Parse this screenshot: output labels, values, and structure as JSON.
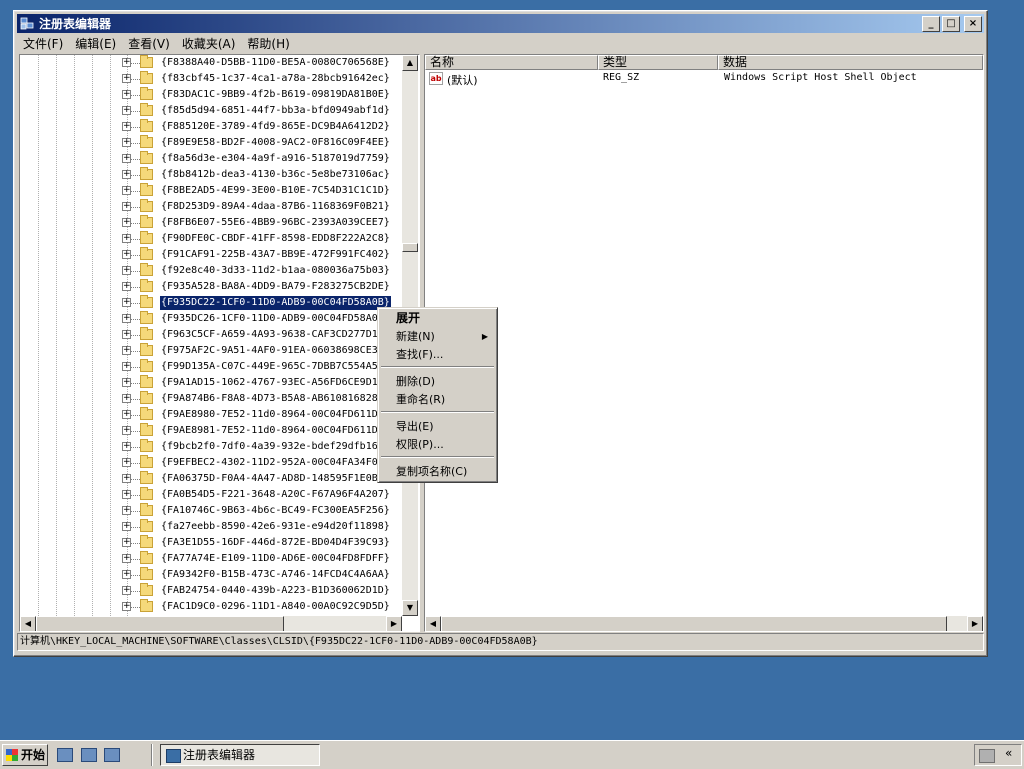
{
  "window": {
    "title": "注册表编辑器",
    "buttons": {
      "minimize": "_",
      "maximize": "□",
      "close": "×"
    }
  },
  "menubar": [
    "文件(F)",
    "编辑(E)",
    "查看(V)",
    "收藏夹(A)",
    "帮助(H)"
  ],
  "tree": {
    "selected_index": 15,
    "items": [
      "{F8388A40-D5BB-11D0-BE5A-0080C706568E}",
      "{f83cbf45-1c37-4ca1-a78a-28bcb91642ec}",
      "{F83DAC1C-9BB9-4f2b-B619-09819DA81B0E}",
      "{f85d5d94-6851-44f7-bb3a-bfd0949abf1d}",
      "{F885120E-3789-4fd9-865E-DC9B4A6412D2}",
      "{F89E9E58-BD2F-4008-9AC2-0F816C09F4EE}",
      "{f8a56d3e-e304-4a9f-a916-5187019d7759}",
      "{f8b8412b-dea3-4130-b36c-5e8be73106ac}",
      "{F8BE2AD5-4E99-3E00-B10E-7C54D31C1C1D}",
      "{F8D253D9-89A4-4daa-87B6-1168369F0B21}",
      "{F8FB6E07-55E6-4BB9-96BC-2393A039CEE7}",
      "{F90DFE0C-CBDF-41FF-8598-EDD8F222A2C8}",
      "{F91CAF91-225B-43A7-BB9E-472F991FC402}",
      "{f92e8c40-3d33-11d2-b1aa-080036a75b03}",
      "{F935A528-BA8A-4DD9-BA79-F283275CB2DE}",
      "{F935DC22-1CF0-11D0-ADB9-00C04FD58A0B}",
      "{F935DC26-1CF0-11D0-ADB9-00C04FD58A0B}",
      "{F963C5CF-A659-4A93-9638-CAF3CD277D13}",
      "{F975AF2C-9A51-4AF0-91EA-06038698CE38}",
      "{F99D135A-C07C-449E-965C-7DBB7C554A51}",
      "{F9A1AD15-1062-4767-93EC-A56FD6CE9D18}",
      "{F9A874B6-F8A8-4D73-B5A8-AB610816828B}",
      "{F9AE8980-7E52-11d0-8964-00C04FD611D7}",
      "{F9AE8981-7E52-11d0-8964-00C04FD611D7}",
      "{f9bcb2f0-7df0-4a39-932e-bdef29dfb16b}",
      "{F9EFBEC2-4302-11D2-952A-00C04FA34F05}",
      "{FA06375D-F0A4-4A47-AD8D-148595F1E0B6}",
      "{FA0B54D5-F221-3648-A20C-F67A96F4A207}",
      "{FA10746C-9B63-4b6c-BC49-FC300EA5F256}",
      "{fa27eebb-8590-42e6-931e-e94d20f11898}",
      "{FA3E1D55-16DF-446d-872E-BD04D4F39C93}",
      "{FA77A74E-E109-11D0-AD6E-00C04FD8FDFF}",
      "{FA9342F0-B15B-473C-A746-14FCD4C4A6AA}",
      "{FAB24754-0440-439b-A223-B1D360062D1D}",
      "{FAC1D9C0-0296-11D1-A840-00A0C92C9D5D}"
    ]
  },
  "list": {
    "columns": [
      "名称",
      "类型",
      "数据"
    ],
    "rows": [
      {
        "icon": "ab",
        "name": "(默认)",
        "type": "REG_SZ",
        "data": "Windows Script Host Shell Object"
      }
    ]
  },
  "statusbar": "计算机\\HKEY_LOCAL_MACHINE\\SOFTWARE\\Classes\\CLSID\\{F935DC22-1CF0-11D0-ADB9-00C04FD58A0B}",
  "context_menu": {
    "expand": "展开",
    "new": "新建(N)",
    "find": "查找(F)...",
    "delete": "删除(D)",
    "rename": "重命名(R)",
    "export": "导出(E)",
    "permissions": "权限(P)...",
    "copy_key_name": "复制项名称(C)"
  },
  "taskbar": {
    "start": "开始",
    "task": "注册表编辑器"
  }
}
